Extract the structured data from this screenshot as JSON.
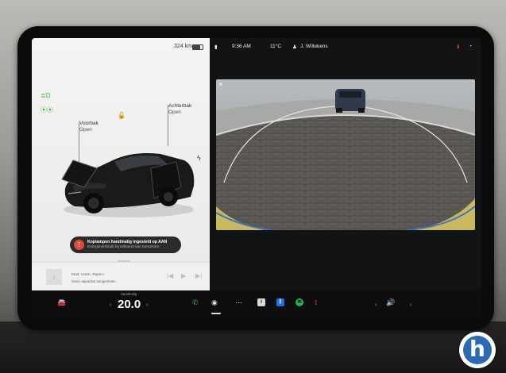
{
  "left_panel": {
    "range": "324 km",
    "frunk_title": "Voorbak",
    "frunk_state": "Open",
    "trunk_title": "Achterbak",
    "trunk_state": "Open",
    "alert_title": "Koplampen handmatig ingesteld op AAN",
    "alert_sub": "Energieverbruik bij stilstand kan toenemen",
    "media_title": "Mod. Uurtn. Ripen+",
    "media_sub": "Geen apparaat aangesloten"
  },
  "status_bar": {
    "time": "9:36 AM",
    "outside_temp": "11°C",
    "profile": "J. Willekens"
  },
  "taskbar": {
    "temp_label": "Handmatig",
    "temp_value": "20.0"
  },
  "colors": {
    "accent_green": "#2cbf4a",
    "alert_red": "#e2483a",
    "download_orange": "#e84d2d",
    "bluetooth_blue": "#1e6fe0",
    "spotify_green": "#1db954"
  },
  "icons": [
    "lock-icon",
    "lightning-icon",
    "warning-icon",
    "music-note-icon",
    "car-icon",
    "phone-icon",
    "camera-icon",
    "dots-icon",
    "info-icon",
    "bluetooth-icon",
    "spotify-icon",
    "joystick-icon",
    "volume-icon",
    "download-icon"
  ]
}
